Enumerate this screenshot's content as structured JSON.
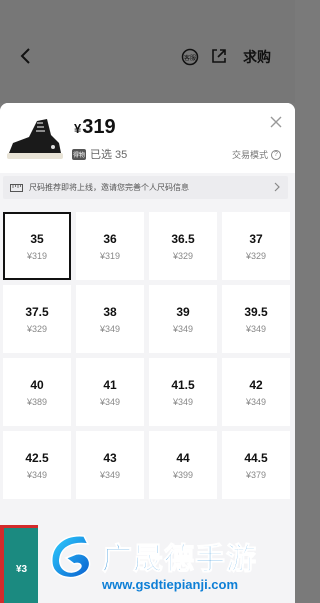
{
  "header": {
    "buy_label": "求购",
    "service_label": "客服"
  },
  "product": {
    "currency": "¥",
    "price": "319",
    "badge": "得物",
    "selected_text": "已选 35",
    "mode_label": "交易模式",
    "mode_help": "?"
  },
  "notice": {
    "text": "尺码推荐即将上线，邀请您完善个人尺码信息"
  },
  "sizes": [
    {
      "size": "35",
      "price": "¥319"
    },
    {
      "size": "36",
      "price": "¥319"
    },
    {
      "size": "36.5",
      "price": "¥329"
    },
    {
      "size": "37",
      "price": "¥329"
    },
    {
      "size": "37.5",
      "price": "¥329"
    },
    {
      "size": "38",
      "price": "¥349"
    },
    {
      "size": "39",
      "price": "¥349"
    },
    {
      "size": "39.5",
      "price": "¥349"
    },
    {
      "size": "40",
      "price": "¥389"
    },
    {
      "size": "41",
      "price": "¥349"
    },
    {
      "size": "41.5",
      "price": "¥349"
    },
    {
      "size": "42",
      "price": "¥349"
    },
    {
      "size": "42.5",
      "price": "¥349"
    },
    {
      "size": "43",
      "price": "¥349"
    },
    {
      "size": "44",
      "price": "¥399"
    },
    {
      "size": "44.5",
      "price": "¥379"
    }
  ],
  "bottom": {
    "price_fragment": "¥3"
  },
  "watermark": {
    "title": "广晟德手游",
    "url": "www.gsdtiepianji.com"
  },
  "colors": {
    "accent_teal": "#1b8a80",
    "watermark_blue": "#0e7fd6",
    "highlight_red": "#d32b2b"
  }
}
